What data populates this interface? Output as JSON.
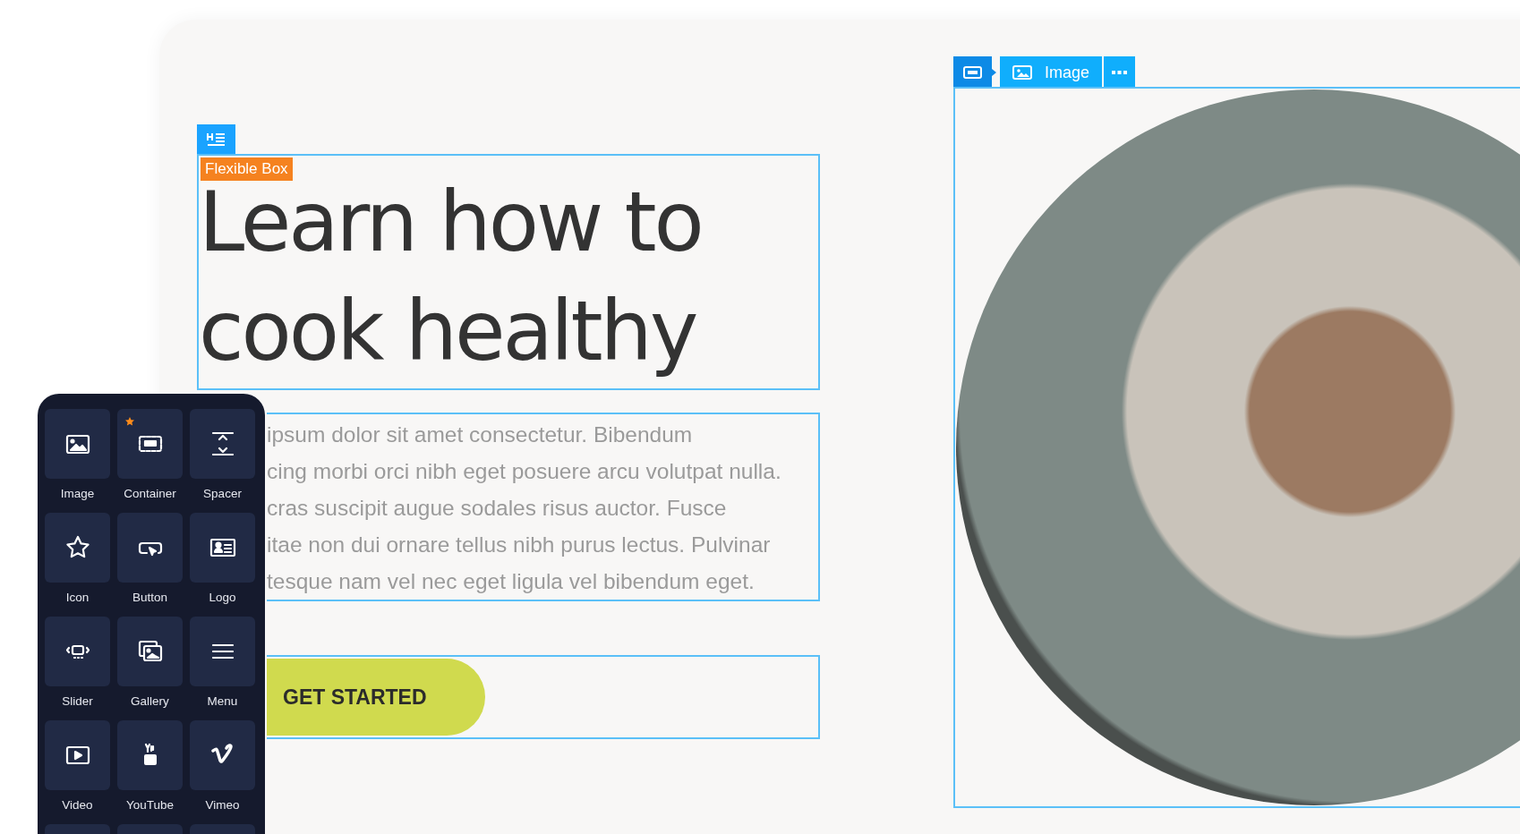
{
  "canvas": {
    "box_label": "Flexible Box",
    "heading_lines": [
      "Learn how to",
      "cook healthy"
    ],
    "paragraph_lines": [
      "ipsum dolor sit amet consectetur. Bibendum",
      "cing morbi orci nibh eget posuere arcu volutpat nulla.",
      "cras suscipit augue sodales risus auctor. Fusce",
      "itae non dui ornare tellus nibh purus lectus. Pulvinar",
      "tesque nam vel nec eget ligula vel bibendum eget."
    ],
    "button": "GET STARTED"
  },
  "image_widget": {
    "toolbar_label": "Image"
  },
  "widget_panel": {
    "items": [
      {
        "label": "Image",
        "kind": "image",
        "favorite": false
      },
      {
        "label": "Container",
        "kind": "container",
        "favorite": true
      },
      {
        "label": "Spacer",
        "kind": "spacer",
        "favorite": false
      },
      {
        "label": "Icon",
        "kind": "star",
        "favorite": false
      },
      {
        "label": "Button",
        "kind": "button",
        "favorite": false
      },
      {
        "label": "Logo",
        "kind": "logo",
        "favorite": false
      },
      {
        "label": "Slider",
        "kind": "slider",
        "favorite": false
      },
      {
        "label": "Gallery",
        "kind": "gallery",
        "favorite": false
      },
      {
        "label": "Menu",
        "kind": "menu",
        "favorite": false
      },
      {
        "label": "Video",
        "kind": "video",
        "favorite": false
      },
      {
        "label": "YouTube",
        "kind": "youtube",
        "favorite": false
      },
      {
        "label": "Vimeo",
        "kind": "vimeo",
        "favorite": false
      }
    ]
  }
}
